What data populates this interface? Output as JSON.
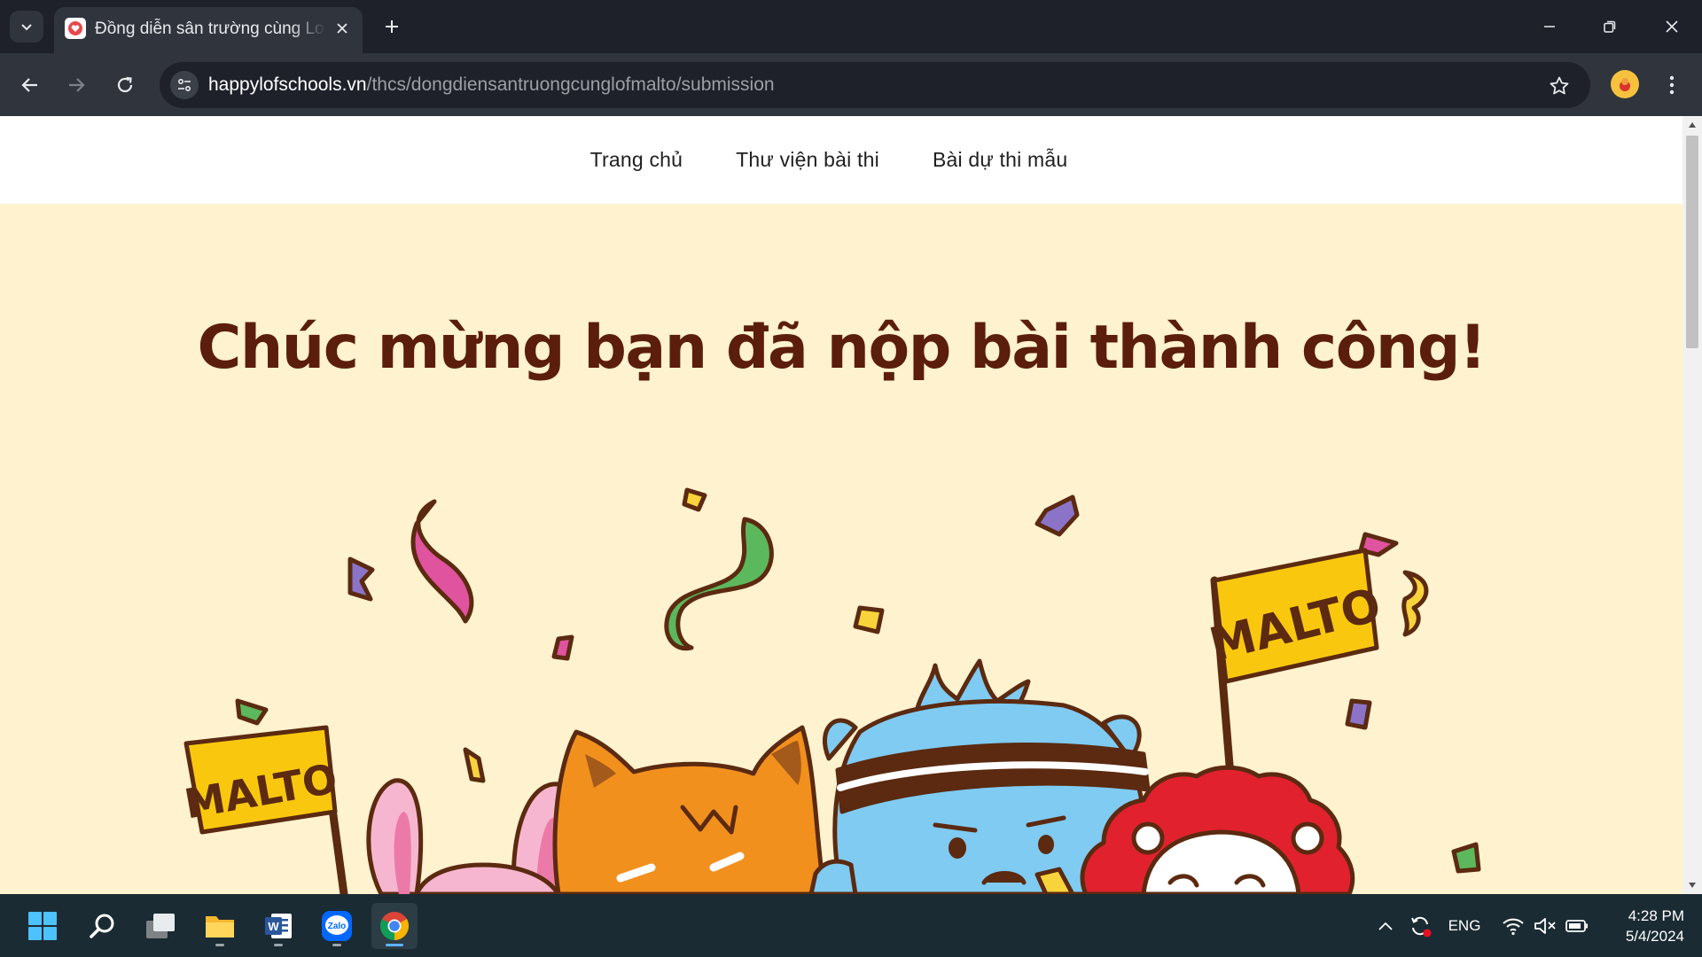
{
  "browser": {
    "tab_title": "Đồng diễn sân trường cùng Lof",
    "url_host": "happylofschools.vn",
    "url_path": "/thcs/dongdiensantruongcunglofmalto/submission"
  },
  "site": {
    "nav": [
      "Trang chủ",
      "Thư viện bài thi",
      "Bài dự thi mẫu"
    ],
    "headline": "Chúc mừng bạn đã nộp bài thành công!",
    "flag_text": "MALTO"
  },
  "taskbar": {
    "apps": [
      "start-icon",
      "search-icon",
      "task-view-icon",
      "file-explorer-icon",
      "word-icon",
      "zalo-icon",
      "chrome-icon"
    ],
    "zalo_label": "Zalo",
    "word_label": "W",
    "language": "ENG",
    "time": "4:28 PM",
    "date": "5/4/2024"
  },
  "colors": {
    "headline": "#5b1d0c",
    "page_bg": "#fff2cf",
    "flag": "#f9c80e",
    "chrome_bg": "#1e2129",
    "taskbar": "#1b2b33"
  }
}
